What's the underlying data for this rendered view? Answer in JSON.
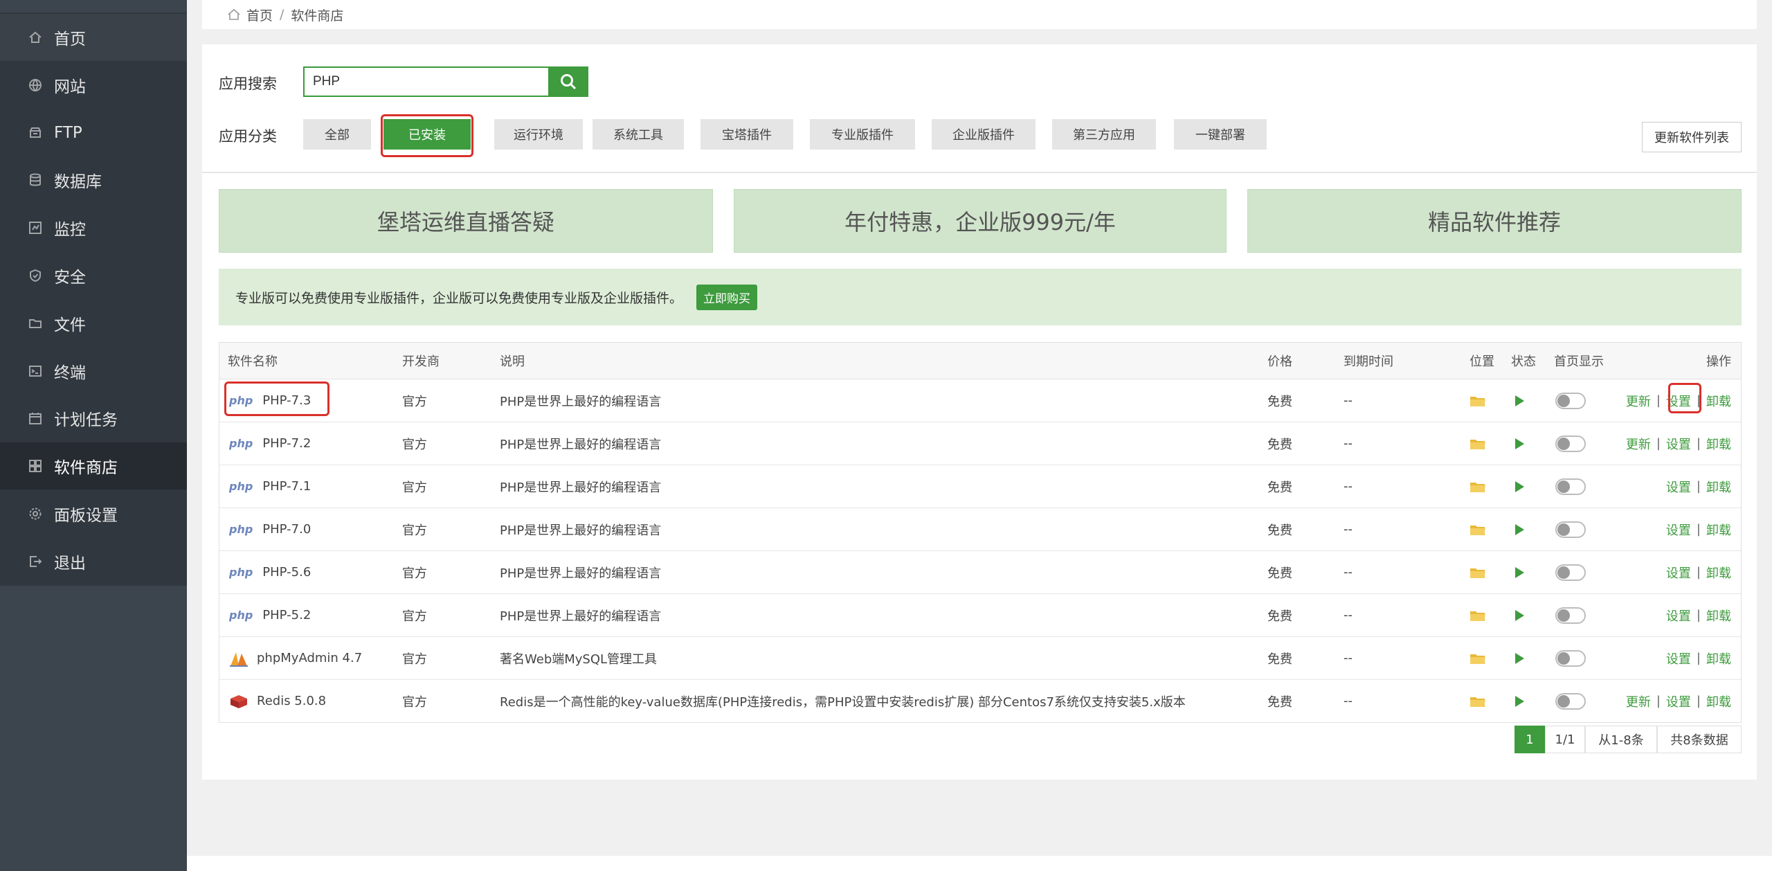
{
  "sidebar": {
    "items": [
      {
        "label": "首页",
        "icon": "home-icon"
      },
      {
        "label": "网站",
        "icon": "globe-icon"
      },
      {
        "label": "FTP",
        "icon": "ftp-icon"
      },
      {
        "label": "数据库",
        "icon": "database-icon"
      },
      {
        "label": "监控",
        "icon": "monitor-icon"
      },
      {
        "label": "安全",
        "icon": "shield-icon"
      },
      {
        "label": "文件",
        "icon": "folder-icon"
      },
      {
        "label": "终端",
        "icon": "terminal-icon"
      },
      {
        "label": "计划任务",
        "icon": "calendar-icon"
      },
      {
        "label": "软件商店",
        "icon": "grid-icon"
      },
      {
        "label": "面板设置",
        "icon": "gear-icon"
      },
      {
        "label": "退出",
        "icon": "logout-icon"
      }
    ]
  },
  "breadcrumb": {
    "home": "首页",
    "separator": "/",
    "current": "软件商店"
  },
  "search": {
    "label": "应用搜索",
    "value": "PHP"
  },
  "categories": {
    "label": "应用分类",
    "items": [
      "全部",
      "已安装",
      "运行环境",
      "系统工具",
      "宝塔插件",
      "专业版插件",
      "企业版插件",
      "第三方应用",
      "一键部署"
    ],
    "selected": "已安装"
  },
  "refresh_label": "更新软件列表",
  "banners": [
    "堡塔运维直播答疑",
    "年付特惠，企业版999元/年",
    "精品软件推荐"
  ],
  "notice": {
    "text": "专业版可以免费使用专业版插件，企业版可以免费使用专业版及企业版插件。",
    "button": "立即购买"
  },
  "table": {
    "headers": {
      "name": "软件名称",
      "developer": "开发商",
      "desc": "说明",
      "price": "价格",
      "expire": "到期时间",
      "location": "位置",
      "status": "状态",
      "homepage": "首页显示",
      "ops": "操作"
    },
    "op_labels": {
      "update": "更新",
      "settings": "设置",
      "uninstall": "卸载",
      "separator": "|"
    },
    "rows": [
      {
        "logo": "php",
        "name": "PHP-7.3",
        "developer": "官方",
        "desc": "PHP是世界上最好的编程语言",
        "price": "免费",
        "expire": "--",
        "update": true
      },
      {
        "logo": "php",
        "name": "PHP-7.2",
        "developer": "官方",
        "desc": "PHP是世界上最好的编程语言",
        "price": "免费",
        "expire": "--",
        "update": true
      },
      {
        "logo": "php",
        "name": "PHP-7.1",
        "developer": "官方",
        "desc": "PHP是世界上最好的编程语言",
        "price": "免费",
        "expire": "--",
        "update": false
      },
      {
        "logo": "php",
        "name": "PHP-7.0",
        "developer": "官方",
        "desc": "PHP是世界上最好的编程语言",
        "price": "免费",
        "expire": "--",
        "update": false
      },
      {
        "logo": "php",
        "name": "PHP-5.6",
        "developer": "官方",
        "desc": "PHP是世界上最好的编程语言",
        "price": "免费",
        "expire": "--",
        "update": false
      },
      {
        "logo": "php",
        "name": "PHP-5.2",
        "developer": "官方",
        "desc": "PHP是世界上最好的编程语言",
        "price": "免费",
        "expire": "--",
        "update": false
      },
      {
        "logo": "phpmyadmin",
        "name": "phpMyAdmin 4.7",
        "developer": "官方",
        "desc": "著名Web端MySQL管理工具",
        "price": "免费",
        "expire": "--",
        "update": false
      },
      {
        "logo": "redis",
        "name": "Redis 5.0.8",
        "developer": "官方",
        "desc": "Redis是一个高性能的key-value数据库(PHP连接redis，需PHP设置中安装redis扩展) 部分Centos7系统仅支持安装5.x版本",
        "price": "免费",
        "expire": "--",
        "update": true
      }
    ]
  },
  "pagination": {
    "current": "1",
    "pages": "1/1",
    "range": "从1-8条",
    "total": "共8条数据"
  },
  "colors": {
    "accent": "#3e9b3e",
    "highlight": "#d9302a",
    "sidebar": "#30373f"
  }
}
